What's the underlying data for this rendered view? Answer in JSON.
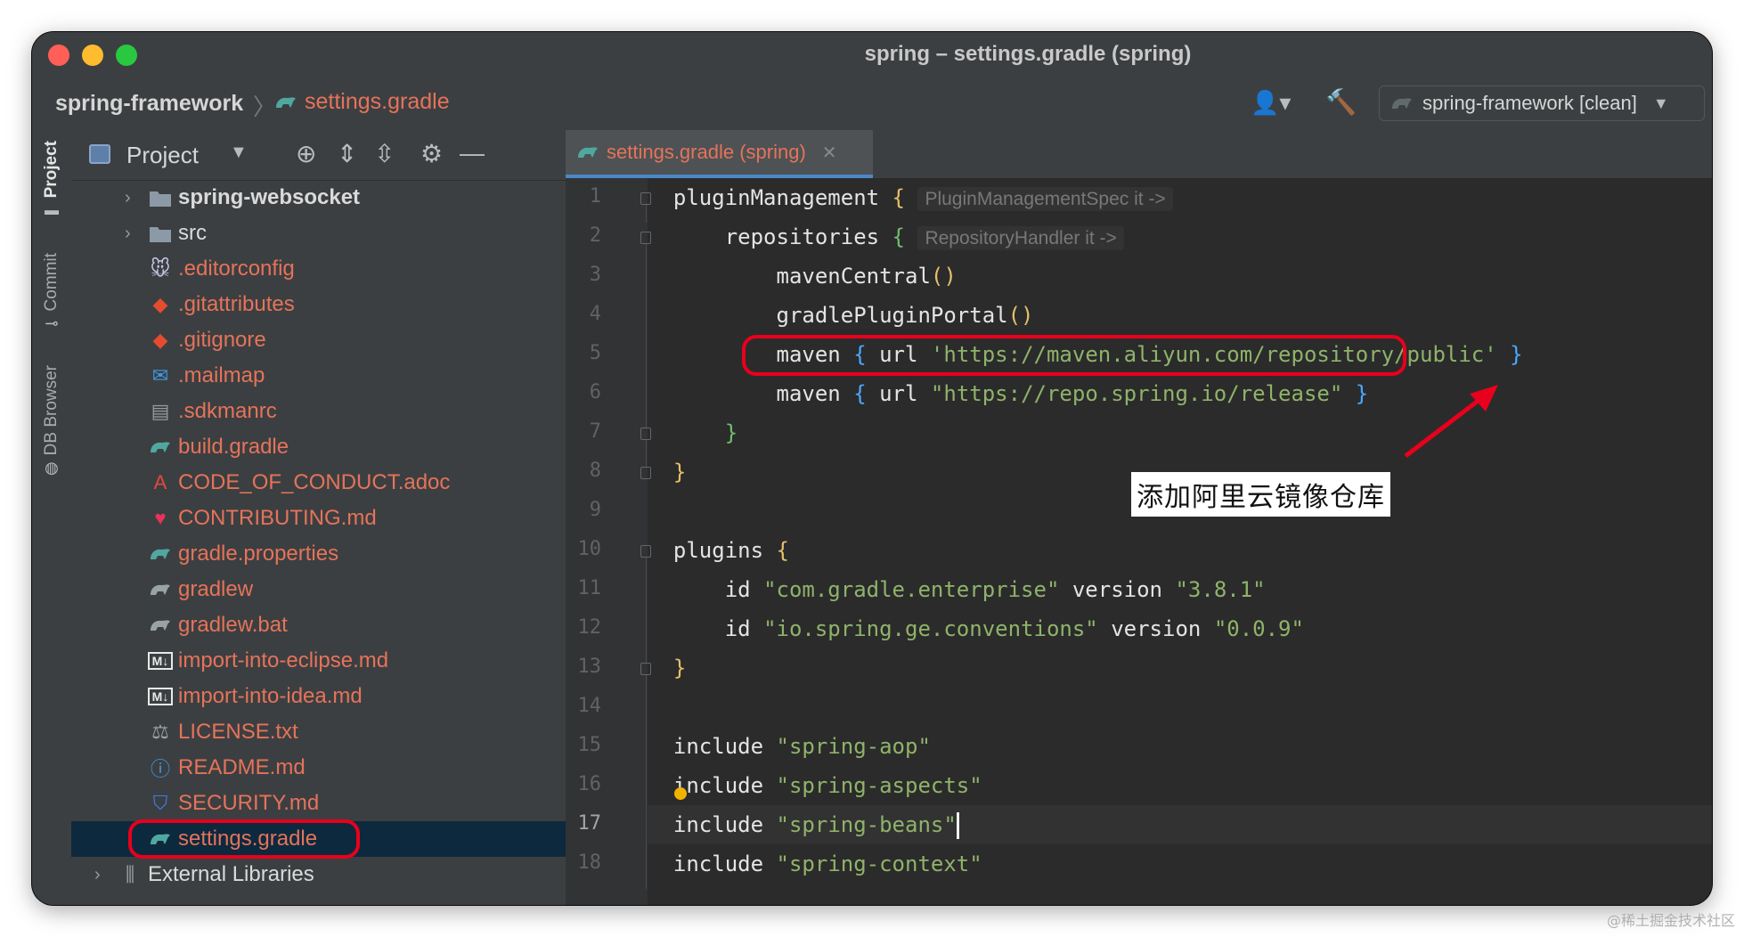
{
  "window": {
    "title": "spring – settings.gradle (spring)"
  },
  "navbar": {
    "breadcrumb_root": "spring-framework",
    "breadcrumb_file": "settings.gradle",
    "run_config": "spring-framework [clean]"
  },
  "sidebar_tabs": [
    "Project",
    "Commit",
    "DB Browser"
  ],
  "project_panel": {
    "title": "Project",
    "items": [
      {
        "name": "spring-websocket",
        "icon": "folder-icon"
      },
      {
        "name": "src",
        "icon": "folder-icon"
      },
      {
        "name": ".editorconfig",
        "icon": "editorconfig-icon"
      },
      {
        "name": ".gitattributes",
        "icon": "git-icon"
      },
      {
        "name": ".gitignore",
        "icon": "git-icon"
      },
      {
        "name": ".mailmap",
        "icon": "mail-icon"
      },
      {
        "name": ".sdkmanrc",
        "icon": "text-file-icon"
      },
      {
        "name": "build.gradle",
        "icon": "gradle-icon"
      },
      {
        "name": "CODE_OF_CONDUCT.adoc",
        "icon": "asciidoc-icon"
      },
      {
        "name": "CONTRIBUTING.md",
        "icon": "heart-icon"
      },
      {
        "name": "gradle.properties",
        "icon": "gradle-icon"
      },
      {
        "name": "gradlew",
        "icon": "gradle-icon"
      },
      {
        "name": "gradlew.bat",
        "icon": "gradle-icon"
      },
      {
        "name": "import-into-eclipse.md",
        "icon": "markdown-icon"
      },
      {
        "name": "import-into-idea.md",
        "icon": "markdown-icon"
      },
      {
        "name": "LICENSE.txt",
        "icon": "license-icon"
      },
      {
        "name": "README.md",
        "icon": "info-icon"
      },
      {
        "name": "SECURITY.md",
        "icon": "shield-icon"
      },
      {
        "name": "settings.gradle",
        "icon": "gradle-icon"
      },
      {
        "name": "External Libraries",
        "icon": "libraries-icon"
      }
    ]
  },
  "editor": {
    "tab_label": "settings.gradle (spring)",
    "lines": {
      "l1": {
        "a": "pluginManagement",
        "b": "{",
        "hint": "PluginManagementSpec it ->"
      },
      "l2": {
        "a": "repositories",
        "b": "{",
        "hint": "RepositoryHandler it ->"
      },
      "l3": {
        "a": "mavenCentral",
        "b": "()"
      },
      "l4": {
        "a": "gradlePluginPortal",
        "b": "()"
      },
      "l5": {
        "a": "maven",
        "b": "{",
        "c": "url",
        "s": "'https://maven.aliyun.com/repository/public'",
        "d": "}"
      },
      "l6": {
        "a": "maven",
        "b": "{",
        "c": "url",
        "s": "\"https://repo.spring.io/release\"",
        "d": "}"
      },
      "l7": {
        "b": "}"
      },
      "l8": {
        "b": "}"
      },
      "l10": {
        "a": "plugins",
        "b": "{"
      },
      "l11": {
        "a": "id",
        "s": "\"com.gradle.enterprise\"",
        "c": "version",
        "s2": "\"3.8.1\""
      },
      "l12": {
        "a": "id",
        "s": "\"io.spring.ge.conventions\"",
        "c": "version",
        "s2": "\"0.0.9\""
      },
      "l13": {
        "b": "}"
      },
      "l15": {
        "a": "include",
        "s": "\"spring-aop\""
      },
      "l16": {
        "a": "include",
        "s": "\"spring-aspects\""
      },
      "l17": {
        "a": "include",
        "s": "\"spring-beans\""
      },
      "l18": {
        "a": "include",
        "s": "\"spring-context\""
      }
    },
    "line_numbers": [
      "1",
      "2",
      "3",
      "4",
      "5",
      "6",
      "7",
      "8",
      "9",
      "10",
      "11",
      "12",
      "13",
      "14",
      "15",
      "16",
      "17",
      "18"
    ]
  },
  "annotation": {
    "text": "添加阿里云镜像仓库"
  },
  "watermark": "@稀土掘金技术社区",
  "colors": {
    "highlight": "#e8001c",
    "selected_row": "#0d293e",
    "file_text": "#e5735a"
  }
}
